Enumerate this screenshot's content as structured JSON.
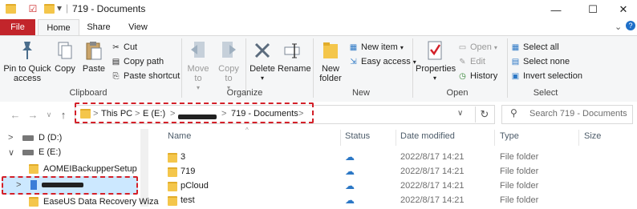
{
  "window": {
    "title": "719 - Documents",
    "controls": {
      "minimize": "—",
      "maximize": "☐",
      "close": "✕"
    },
    "qat_separator": "|",
    "qat_dropdown": "▾"
  },
  "tabs": [
    "File",
    "Home",
    "Share",
    "View"
  ],
  "ribbon": {
    "clipboard": {
      "label": "Clipboard",
      "pin": "Pin to Quick access",
      "copy": "Copy",
      "paste": "Paste",
      "cut": "Cut",
      "copy_path": "Copy path",
      "paste_shortcut": "Paste shortcut"
    },
    "organize": {
      "label": "Organize",
      "move_to": "Move to",
      "copy_to": "Copy to",
      "delete": "Delete",
      "rename": "Rename"
    },
    "new": {
      "label": "New",
      "new_folder": "New folder",
      "new_item": "New item",
      "easy_access": "Easy access"
    },
    "open": {
      "label": "Open",
      "properties": "Properties",
      "open": "Open",
      "edit": "Edit",
      "history": "History"
    },
    "select": {
      "label": "Select",
      "select_all": "Select all",
      "select_none": "Select none",
      "invert": "Invert selection"
    }
  },
  "address": {
    "crumbs": [
      "This PC",
      "E (E:)",
      "719 - Documents"
    ],
    "separator": ">",
    "search_placeholder": "Search 719 - Documents"
  },
  "nav_tree": [
    {
      "label": "D (D:)",
      "kind": "drive",
      "expand": ">"
    },
    {
      "label": "E (E:)",
      "kind": "drive",
      "expand": "∨"
    },
    {
      "label": "AOMEIBackupperSetup",
      "kind": "folder",
      "expand": ""
    },
    {
      "label": "",
      "kind": "redacted",
      "expand": ">"
    },
    {
      "label": "EaseUS Data Recovery Wiza",
      "kind": "folder",
      "expand": ""
    }
  ],
  "columns": [
    "Name",
    "Status",
    "Date modified",
    "Type",
    "Size"
  ],
  "files": [
    {
      "name": "3",
      "status": "cloud",
      "date": "2022/8/17 14:21",
      "type": "File folder",
      "size": ""
    },
    {
      "name": "719",
      "status": "cloud",
      "date": "2022/8/17 14:21",
      "type": "File folder",
      "size": ""
    },
    {
      "name": "pCloud",
      "status": "cloud",
      "date": "2022/8/17 14:21",
      "type": "File folder",
      "size": ""
    },
    {
      "name": "test",
      "status": "cloud",
      "date": "2022/8/17 14:21",
      "type": "File folder",
      "size": ""
    }
  ],
  "colors": {
    "file_tab": "#c2252b",
    "highlight": "#d32029",
    "folder": "#f4c64b",
    "cloud": "#2b77c5"
  }
}
